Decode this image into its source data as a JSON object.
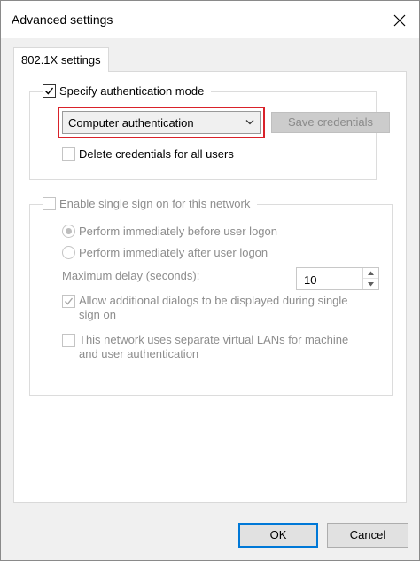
{
  "window": {
    "title": "Advanced settings"
  },
  "tabs": [
    {
      "label": "802.1X settings"
    }
  ],
  "auth_group": {
    "checkbox_label": "Specify authentication mode",
    "checked": true,
    "mode_select": {
      "selected": "Computer authentication"
    },
    "save_credentials_label": "Save credentials",
    "delete_credentials_label": "Delete credentials for all users"
  },
  "sso_group": {
    "checkbox_label": "Enable single sign on for this network",
    "radio_before": "Perform immediately before user logon",
    "radio_after": "Perform immediately after user logon",
    "max_delay_label": "Maximum delay (seconds):",
    "max_delay_value": "10",
    "allow_dialogs_label": "Allow additional dialogs to be displayed during single sign on",
    "separate_vlans_label": "This network uses separate virtual LANs for machine and user authentication"
  },
  "footer": {
    "ok_label": "OK",
    "cancel_label": "Cancel"
  },
  "colors": {
    "highlight": "#d9222a",
    "focus_border": "#0078d7"
  }
}
